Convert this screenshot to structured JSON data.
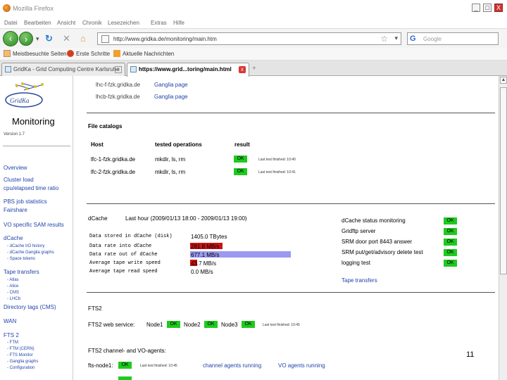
{
  "window": {
    "title": "Mozilla Firefox",
    "minimize": "_",
    "maximize": "□",
    "close": "X"
  },
  "menu": [
    "Datei",
    "Bearbeiten",
    "Ansicht",
    "Chronik",
    "Lesezeichen",
    "Extras",
    "Hilfe"
  ],
  "nav": {
    "url": "http://www.gridka.de/monitoring/main.htm",
    "search_placeholder": "Google",
    "search_logo": "G"
  },
  "bookmarks": [
    "Meistbesuchte Seiten",
    "Erste Schritte",
    "Aktuelle Nachrichten"
  ],
  "tabs": [
    {
      "label": "GridKa - Grid Computing Centre Karlsruhe"
    },
    {
      "label": "https://www.grid...toring/main.html"
    }
  ],
  "sidebar": {
    "brand": "GridKa",
    "title": "Monitoring",
    "version": "Version 1.7",
    "links": [
      "Overview",
      "Cluster load",
      "cpu/elapsed time ratio",
      "PBS job statistics",
      "Fairshare",
      "VO specific SAM results",
      "dCache"
    ],
    "dcache_sub": [
      "- dCache I/O history",
      "- dCache Ganglia graphs",
      "- Space tokens"
    ],
    "tape": "Tape transfers",
    "tape_sub": [
      "- Atlas",
      "- Alice",
      "- CMS",
      "- LHCb"
    ],
    "dir": "Directory tags (CMS)",
    "wan": "WAN",
    "fts": "FTS 2",
    "fts_sub": [
      "- FTM",
      "- FTM (CERN)",
      "- FTS Monitor",
      "- Ganglia graphs",
      "- Configuration"
    ]
  },
  "top_hosts": [
    {
      "host": "lhc-f-fzk.gridka.de",
      "link": "Ganglia page"
    },
    {
      "host": "lhcb-fzk.gridka.de",
      "link": "Ganglia page"
    }
  ],
  "file_catalogs": {
    "title": "File catalogs",
    "headers": [
      "Host",
      "tested operations",
      "result"
    ],
    "rows": [
      {
        "host": "lfc-1-fzk.gridka.de",
        "ops": "mkdir, ls, rm",
        "result": "OK",
        "finished": "Last test finished: 10:40"
      },
      {
        "host": "lfc-2-fzk.gridka.de",
        "ops": "mkdir, ls, rm",
        "result": "OK",
        "finished": "Last test finished: 10:41"
      }
    ]
  },
  "dcache": {
    "title": "dCache",
    "period": "Last hour (2009/01/13 18:00 - 2009/01/13 19:00)",
    "metrics": [
      {
        "label": "Data stored in dCache (disk)",
        "value": "1405.0 TBytes",
        "fill": ""
      },
      {
        "label": "Data rate into dCache",
        "value": "281.8 MB/s",
        "fill": "#c81414"
      },
      {
        "label": "Data rate out of dCache",
        "value": "677.1 MB/s",
        "fill": "#9a9af0"
      },
      {
        "label": "Average tape write speed",
        "value": "43.7 MB/s",
        "fill": "#c81414"
      },
      {
        "label": "Average tape read speed",
        "value": "0.0 MB/s",
        "fill": ""
      }
    ],
    "checks": [
      {
        "label": "dCache status monitoring",
        "result": "OK"
      },
      {
        "label": "Gridftp server",
        "result": "OK"
      },
      {
        "label": "SRM door port 8443 answer",
        "result": "OK"
      },
      {
        "label": "SRM put/get/advisory delete test",
        "result": "OK"
      },
      {
        "label": "logging test",
        "result": "OK"
      }
    ],
    "tape_link": "Tape transfers"
  },
  "fts2": {
    "title": "FTS2",
    "web_label": "FTS2 web service:",
    "nodes": [
      {
        "name": "Node1",
        "result": "OK"
      },
      {
        "name": "Node2",
        "result": "OK"
      },
      {
        "name": "Node3",
        "result": "OK"
      }
    ],
    "finished": "Last test finished: 10:45",
    "agents_title": "FTS2 channel- and VO-agents:",
    "agent_node": "fts-node1:",
    "agent_result": "OK",
    "agent_finished": "Last test finished: 10:45",
    "link1": "channel agents running",
    "link2": "VO agents running"
  },
  "page_number": "11"
}
